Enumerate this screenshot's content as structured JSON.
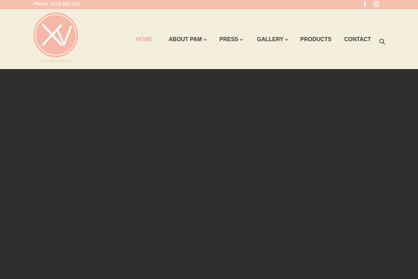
{
  "topbar": {
    "phone": "Phone: 0418 881 329",
    "social": [
      {
        "icon": "facebook-icon"
      },
      {
        "icon": "instagram-icon"
      }
    ]
  },
  "logo": {
    "caption": "XTREME LENGTHS",
    "color": "#f6b7a7"
  },
  "nav": {
    "items": [
      {
        "label": "HOME",
        "active": true,
        "dropdown": false
      },
      {
        "label": "ABOUT PAM",
        "active": false,
        "dropdown": true
      },
      {
        "label": "PRESS",
        "active": false,
        "dropdown": true
      },
      {
        "label": "GALLERY",
        "active": false,
        "dropdown": true
      },
      {
        "label": "PRODUCTS",
        "active": false,
        "dropdown": false
      },
      {
        "label": "CONTACT",
        "active": false,
        "dropdown": false
      }
    ],
    "search_icon": "search-icon"
  },
  "colors": {
    "topbar": "#f6bfae",
    "header": "#f4eedc",
    "accent": "#f3a994",
    "hero": "#2e2e2e"
  }
}
